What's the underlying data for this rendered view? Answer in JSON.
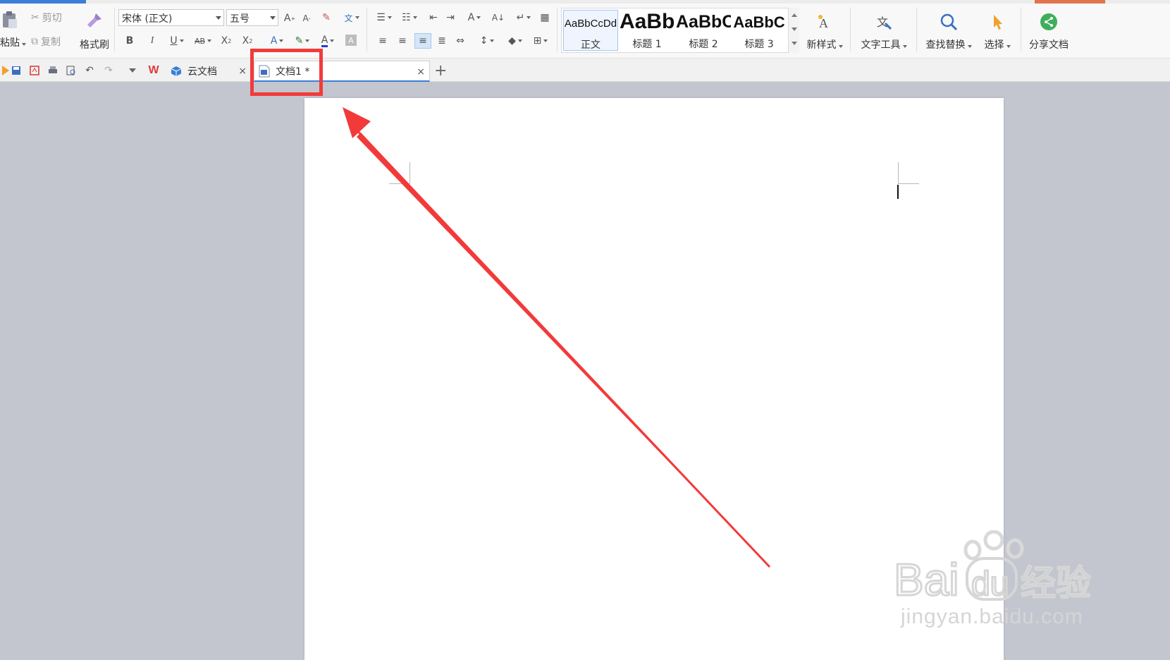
{
  "ribbon": {
    "clipboard": {
      "paste_label": "粘贴",
      "cut_label": "剪切",
      "copy_label": "复制",
      "format_painter_label": "格式刷"
    },
    "font": {
      "family_value": "宋体 (正文)",
      "size_value": "五号"
    },
    "styles": {
      "items": [
        {
          "sample": "AaBbCcDd",
          "name": "正文"
        },
        {
          "sample": "AaBb",
          "name": "标题 1"
        },
        {
          "sample": "AaBbC",
          "name": "标题 2"
        },
        {
          "sample": "AaBbC",
          "name": "标题 3"
        }
      ]
    },
    "new_style_label": "新样式",
    "text_tools_label": "文字工具",
    "find_replace_label": "查找替换",
    "select_label": "选择",
    "share_label": "分享文档"
  },
  "tabs": [
    {
      "label": "云文档"
    },
    {
      "label": "文档1 *"
    }
  ],
  "watermark": {
    "logo_text": "Baidu经验",
    "url_text": "jingyan.baidu.com"
  },
  "colors": {
    "annotation": "#f23a3a",
    "accent": "#3c7fd6",
    "page": "#ffffff",
    "workspace": "#c3c6cf"
  }
}
